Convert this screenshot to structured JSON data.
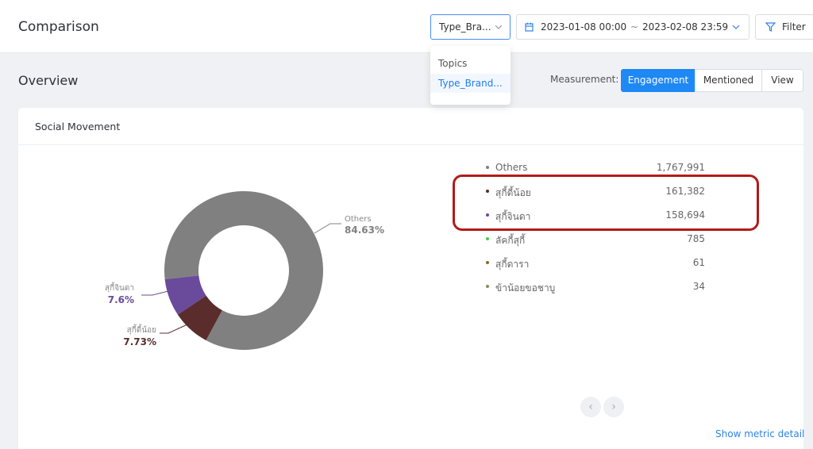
{
  "header": {
    "title": "Comparison",
    "type_select": "Type_Bra...",
    "date_start": "2023-01-08 00:00",
    "date_sep": "~",
    "date_end": "2023-02-08 23:59",
    "filter_label": "Filter"
  },
  "dropdown": {
    "options": [
      "Topics",
      "Type_Brand..."
    ],
    "selected": "Type_Brand..."
  },
  "overview": {
    "title": "Overview",
    "measurement_label": "Measurement:",
    "measurements": [
      "Engagement",
      "Mentioned",
      "View"
    ],
    "active_measurement": "Engagement"
  },
  "card": {
    "title": "Social Movement",
    "show_metric_detail": "Show metric detail",
    "pager_prev": "‹",
    "pager_next": "›"
  },
  "chart_data": {
    "type": "pie",
    "style": "donut",
    "slices": [
      {
        "label": "Others",
        "percent": 84.63,
        "color": "#808080"
      },
      {
        "label": "สุกี้ดี้น้อย",
        "percent": 7.73,
        "color": "#5a2c2c"
      },
      {
        "label": "สุกี้จินดา",
        "percent": 7.6,
        "color": "#6a4a9a"
      }
    ],
    "callouts": [
      {
        "name": "Others",
        "pct": "84.63%"
      },
      {
        "name": "สุกี้จินดา",
        "pct": "7.6%"
      },
      {
        "name": "สุกี้ดี้น้อย",
        "pct": "7.73%"
      }
    ]
  },
  "legend": [
    {
      "name": "Others",
      "value": "1,767,991",
      "color": "#808080"
    },
    {
      "name": "สุกี้ดี้น้อย",
      "value": "161,382",
      "color": "#5a2c2c"
    },
    {
      "name": "สุกี้จินดา",
      "value": "158,694",
      "color": "#6a4a9a"
    },
    {
      "name": "ลัคกี้สุกี้",
      "value": "785",
      "color": "#4cc94c"
    },
    {
      "name": "สุกี้ดารา",
      "value": "61",
      "color": "#8a6a2a"
    },
    {
      "name": "ข้าน้อยขอชาบู",
      "value": "34",
      "color": "#8a8a5a"
    }
  ],
  "colors": {
    "accent": "#1e88f5",
    "highlight": "#b21a1a",
    "link": "#2f83e8"
  }
}
